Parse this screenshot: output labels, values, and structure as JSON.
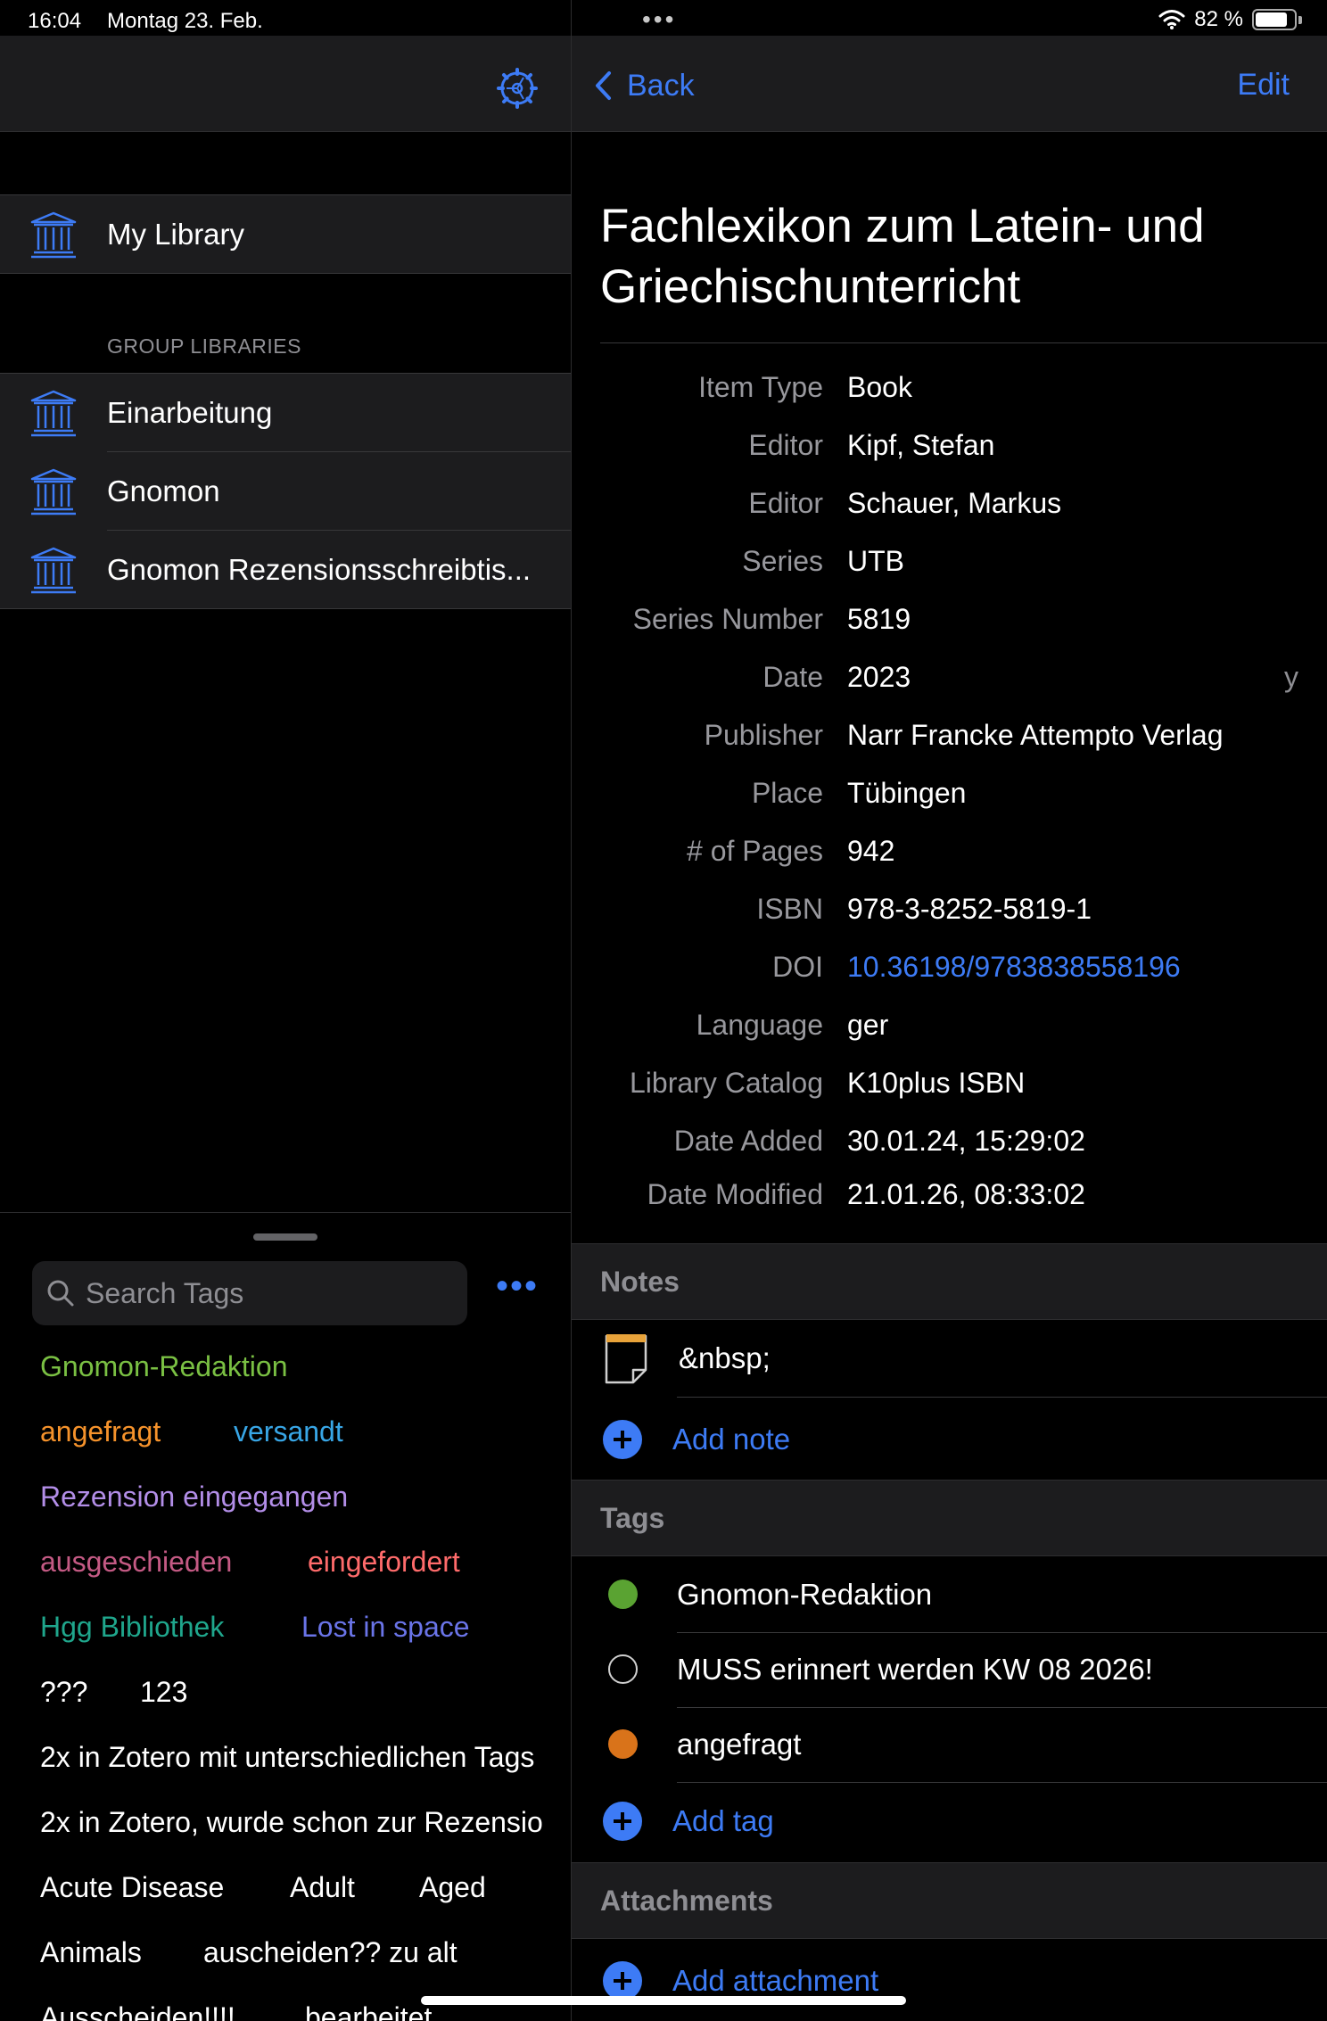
{
  "status_bar": {
    "time": "16:04",
    "date": "Montag 23. Feb.",
    "battery_percent": "82 %"
  },
  "sidebar": {
    "my_library": "My Library",
    "group_header": "GROUP LIBRARIES",
    "groups": [
      "Einarbeitung",
      "Gnomon",
      "Gnomon Rezensionsschreibtis..."
    ]
  },
  "tag_pane": {
    "search_placeholder": "Search Tags",
    "tags": [
      {
        "label": "Gnomon-Redaktion",
        "color": "#7ac043"
      },
      {
        "label": "angefragt",
        "color": "#f5922b"
      },
      {
        "label": "versandt",
        "color": "#38a6e6"
      },
      {
        "label": "Rezension eingegangen",
        "color": "#b38ee8"
      },
      {
        "label": "ausgeschieden",
        "color": "#c45a84"
      },
      {
        "label": "eingefordert",
        "color": "#ff6b6b"
      },
      {
        "label": "Hgg Bibliothek",
        "color": "#1fa68c"
      },
      {
        "label": "Lost in space",
        "color": "#6a74e8"
      },
      {
        "label": "???",
        "color": "#ffffff"
      },
      {
        "label": "123",
        "color": "#ffffff"
      },
      {
        "label": "2x in Zotero mit unterschiedlichen Tags",
        "color": "#ffffff"
      },
      {
        "label": "2x in Zotero, wurde schon zur Rezensio",
        "color": "#ffffff"
      },
      {
        "label": "Acute Disease",
        "color": "#ffffff"
      },
      {
        "label": "Adult",
        "color": "#ffffff"
      },
      {
        "label": "Aged",
        "color": "#ffffff"
      },
      {
        "label": "Animals",
        "color": "#ffffff"
      },
      {
        "label": "auscheiden?? zu alt",
        "color": "#ffffff"
      },
      {
        "label": "Ausscheiden!!!!",
        "color": "#ffffff"
      },
      {
        "label": "bearbeitet",
        "color": "#ffffff"
      }
    ]
  },
  "detail": {
    "back_label": "Back",
    "edit_label": "Edit",
    "title": "Fachlexikon zum Latein- und Griechischunterricht",
    "fields": [
      {
        "key": "Item Type",
        "value": "Book"
      },
      {
        "key": "Editor",
        "value": "Kipf, Stefan"
      },
      {
        "key": "Editor",
        "value": "Schauer, Markus"
      },
      {
        "key": "Series",
        "value": "UTB"
      },
      {
        "key": "Series Number",
        "value": "5819"
      },
      {
        "key": "Date",
        "value": "2023",
        "suffix": "y"
      },
      {
        "key": "Publisher",
        "value": "Narr Francke Attempto Verlag"
      },
      {
        "key": "Place",
        "value": "Tübingen"
      },
      {
        "key": "# of Pages",
        "value": "942"
      },
      {
        "key": "ISBN",
        "value": "978-3-8252-5819-1"
      },
      {
        "key": "DOI",
        "value": "10.36198/9783838558196"
      },
      {
        "key": "Language",
        "value": "ger"
      },
      {
        "key": "Library Catalog",
        "value": "K10plus ISBN"
      },
      {
        "key": "Date Added",
        "value": "30.01.24, 15:29:02"
      },
      {
        "key": "Date Modified",
        "value": "21.01.26, 08:33:02"
      }
    ],
    "notes_header": "Notes",
    "note_text": "&nbsp;",
    "add_note": "Add note",
    "tags_header": "Tags",
    "item_tags": [
      {
        "label": "Gnomon-Redaktion",
        "color": "#5aa332"
      },
      {
        "label": "MUSS erinnert werden KW 08 2026!",
        "color": "none"
      },
      {
        "label": "angefragt",
        "color": "#d9731a"
      }
    ],
    "add_tag": "Add tag",
    "attachments_header": "Attachments",
    "add_attachment": "Add attachment"
  },
  "colors": {
    "accent": "#3d7bf5",
    "background": "#000000",
    "surface": "#1c1c1e"
  }
}
